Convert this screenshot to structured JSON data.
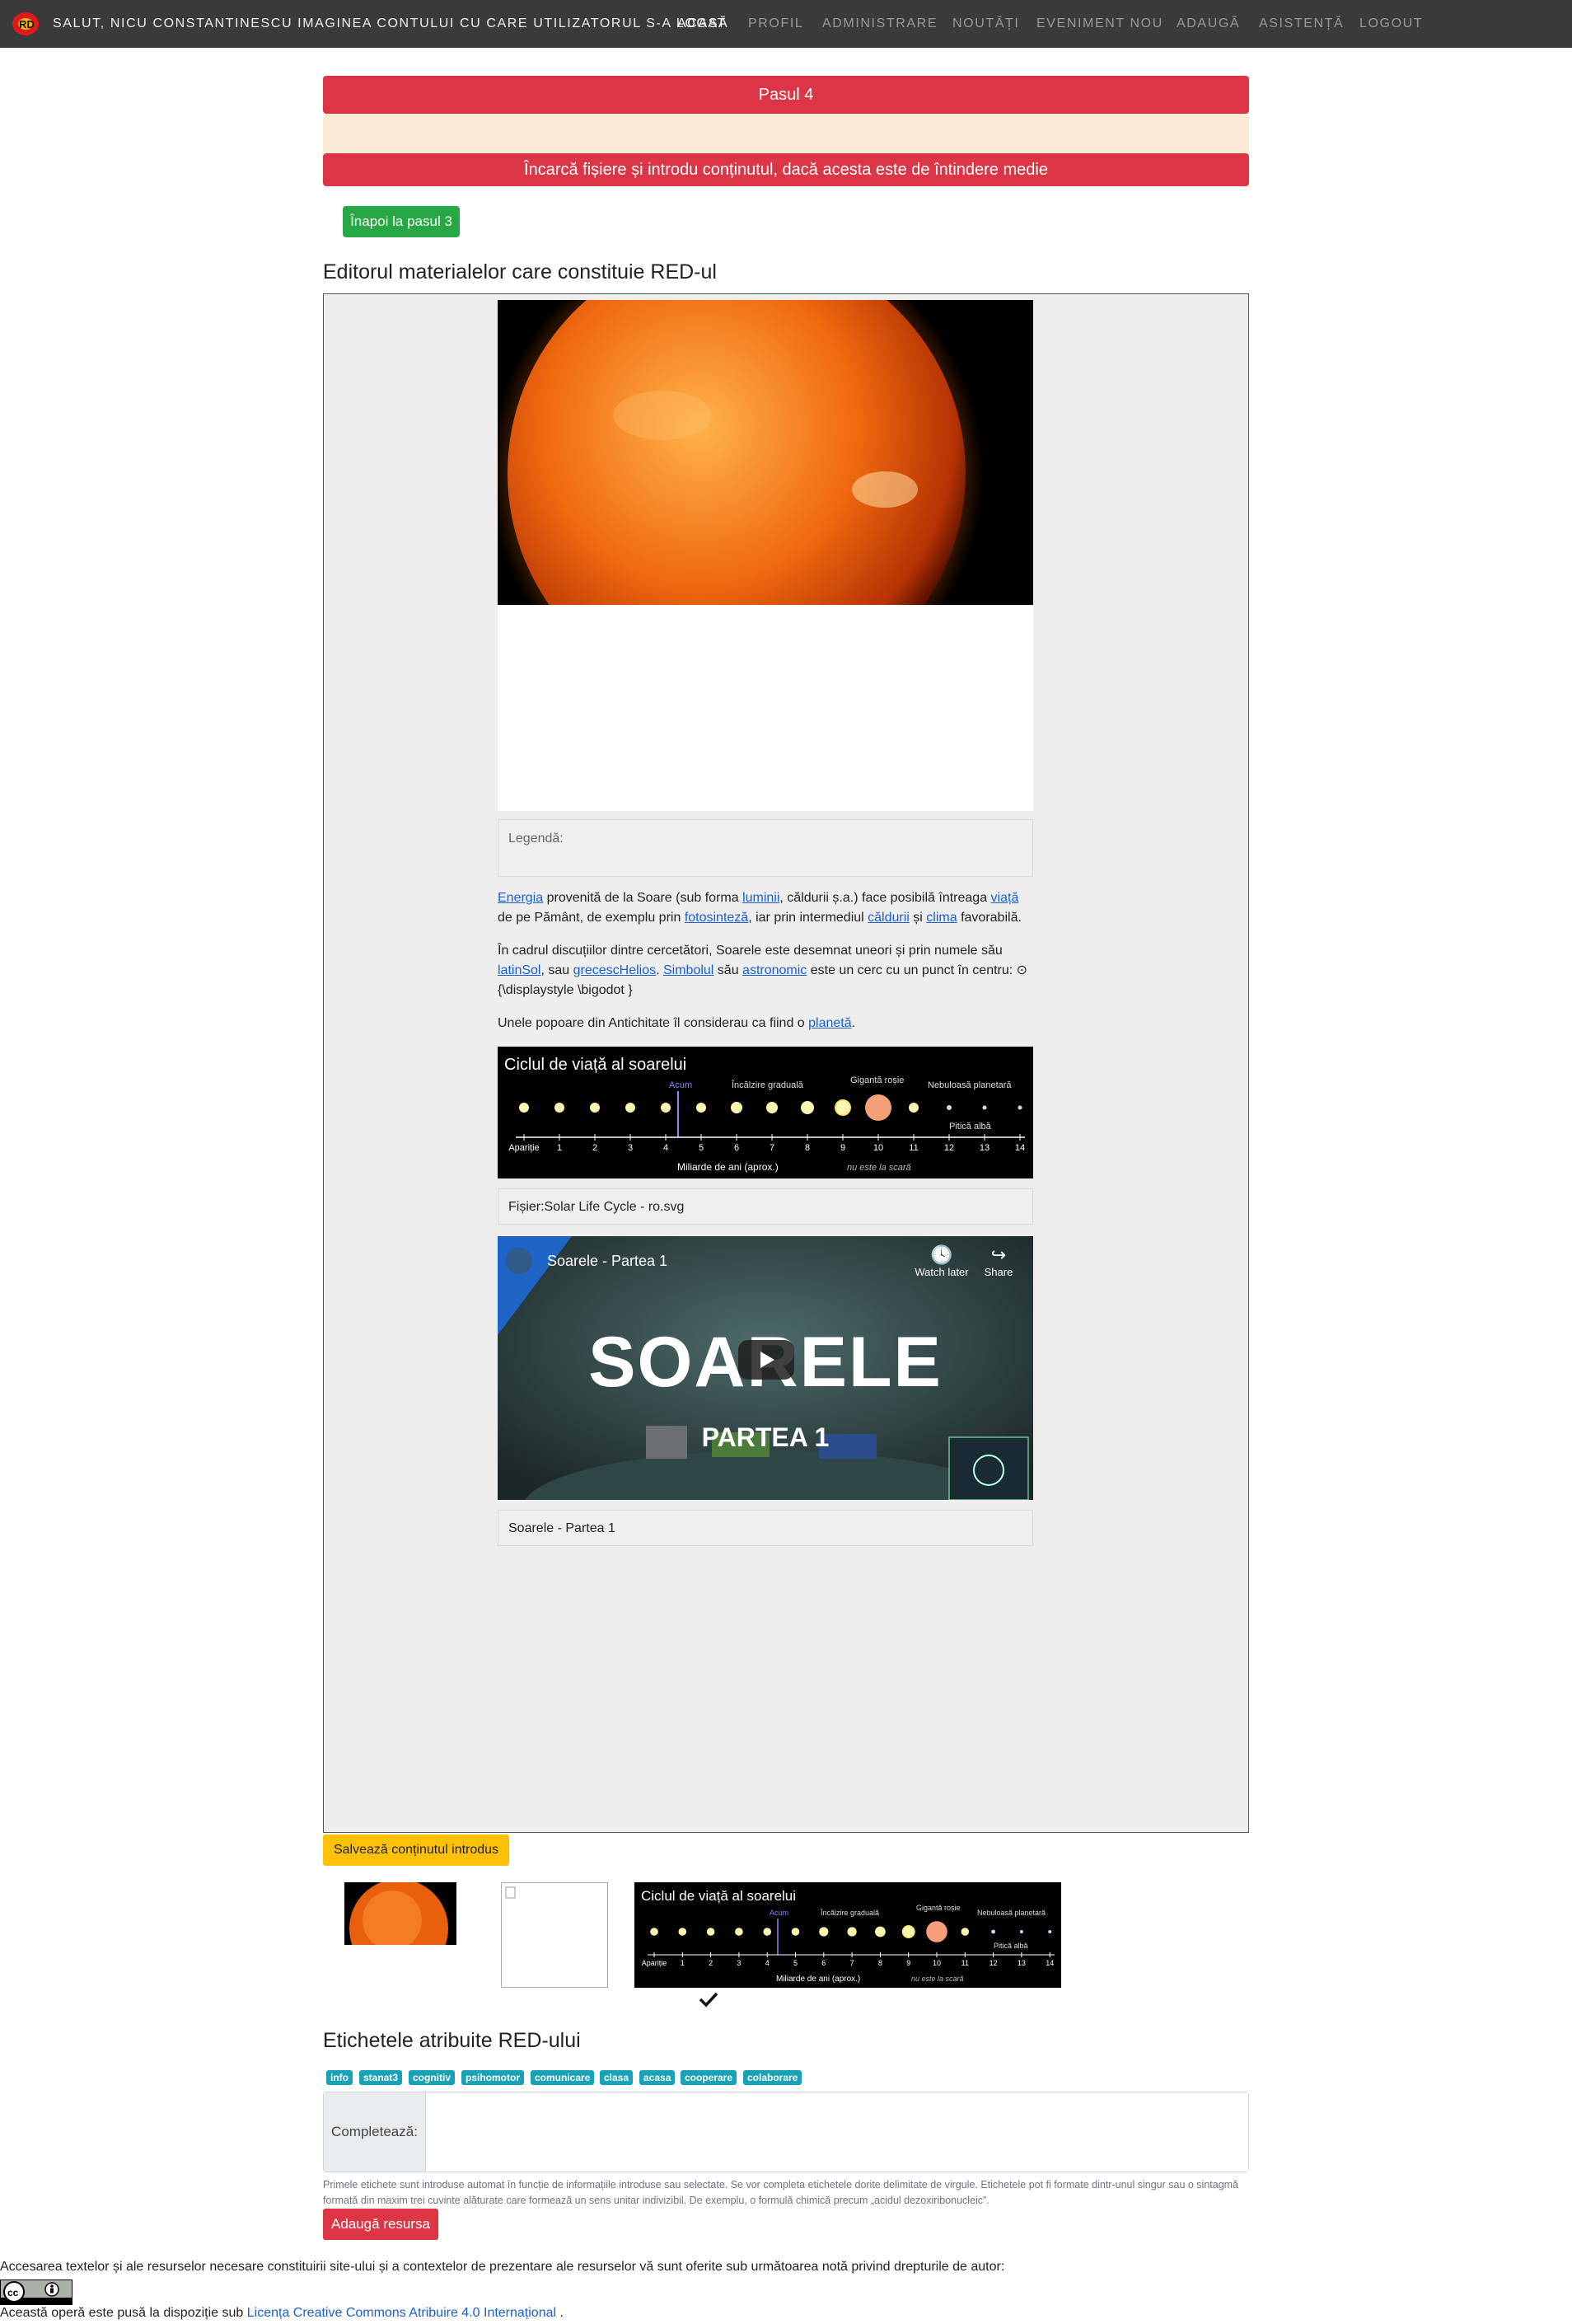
{
  "nav": {
    "greeting": "SALUT, NICU CONSTANTINESCU IMAGINEA CONTULUI CU CARE UTILIZATORUL S-A LOGAT",
    "items": [
      "ACASĂ",
      "PROFIL",
      "ADMINISTRARE",
      "NOUTĂȚI",
      "EVENIMENT NOU",
      "ADAUGĂ",
      "ASISTENȚĂ",
      "LOGOUT"
    ]
  },
  "step": {
    "title": "Pasul 4",
    "instruction": "Încarcă fișiere și introdu conținutul, dacă acesta este de întindere medie",
    "back_button": "Înapoi la pasul 3"
  },
  "editor": {
    "heading": "Editorul materialelor care constituie RED-ul",
    "legend_label": "Legendă:",
    "p1": {
      "link_energia": "Energia",
      "t1": " provenită de la Soare (sub forma ",
      "link_luminii": "luminii",
      "t2": ", căldurii ș.a.) face posibilă întreaga ",
      "link_viata": "viață",
      "t3": " de pe Pământ, de exemplu prin ",
      "link_fotosinteza": "fotosinteză",
      "t4": ", iar prin intermediul ",
      "link_caldurii": "căldurii",
      "t5": " și ",
      "link_clima": "clima",
      "t6": " favorabilă."
    },
    "p2": {
      "t1": "În cadrul discuțiilor dintre cercetători, Soarele este desemnat uneori și prin numele său ",
      "link_latin": "latinSol",
      "t2": ", sau ",
      "link_greces": "grecescHelios",
      "t3": ". ",
      "link_simbolul": "Simbolul",
      "t4": " său ",
      "link_astronomic": "astronomic",
      "t5": " este un cerc cu un punct în centru: ⊙ {\\displaystyle \\bigodot }"
    },
    "p3": {
      "t1": "Unele popoare din Antichitate îl considerau ca fiind o ",
      "link_planeta": "planetă",
      "t2": "."
    },
    "life_cycle": {
      "title": "Ciclul de viață al soarelui",
      "now": "Acum",
      "warming": "Încălzire graduală",
      "red_giant": "Gigantă roșie",
      "nebula": "Nebuloasă planetară",
      "white_dwarf": "Pitică albă",
      "axis_label": "Miliarde de ani (aprox.)",
      "not_to_scale": "nu este la scară",
      "ticks": [
        "Apariție",
        "1",
        "2",
        "3",
        "4",
        "5",
        "6",
        "7",
        "8",
        "9",
        "10",
        "11",
        "12",
        "13",
        "14"
      ]
    },
    "file_caption": "Fișier:Solar Life Cycle - ro.svg",
    "video": {
      "title": "Soarele - Partea 1",
      "watch_later": "Watch later",
      "share": "Share",
      "big_title": "SOARELE",
      "subtitle": "PARTEA 1"
    },
    "video_caption": "Soarele - Partea 1"
  },
  "save_button": "Salvează conținutul introdus",
  "tags": {
    "heading": "Etichetele atribuite RED-ului",
    "items": [
      "info",
      "stanat3",
      "cognitiv",
      "psihomotor",
      "comunicare",
      "clasa",
      "acasa",
      "cooperare",
      "colaborare"
    ],
    "input_label": "Completează:",
    "hint": "Primele etichete sunt introduse automat în funcție de informațiile introduse sau selectate. Se vor completa etichetele dorite delimitate de virgule. Etichetele pot fi formate dintr-unul singur sau o sintagmă formată din maxim trei cuvinte alăturate care formează un sens unitar indivizibil. De exemplu, o formulă chimică precum „acidul dezoxiribonucleic”.",
    "add_button": "Adaugă resursa"
  },
  "footer": {
    "notice": "Accesarea textelor și ale resurselor necesare constituirii site-ului și a contextelor de prezentare ale resurselor vă sunt oferite sub următoarea notă privind drepturile de autor:",
    "license_prefix": "Această operă este pusă la dispoziție sub ",
    "license_link": "Licența Creative Commons Atribuire 4.0 Internațional",
    "license_suffix": " ."
  },
  "colors": {
    "navbar": "#3a3a3a",
    "danger": "#dc3545",
    "success": "#28a745",
    "warning": "#ffc107",
    "info": "#17a2b8",
    "beige": "#fcebd6"
  }
}
